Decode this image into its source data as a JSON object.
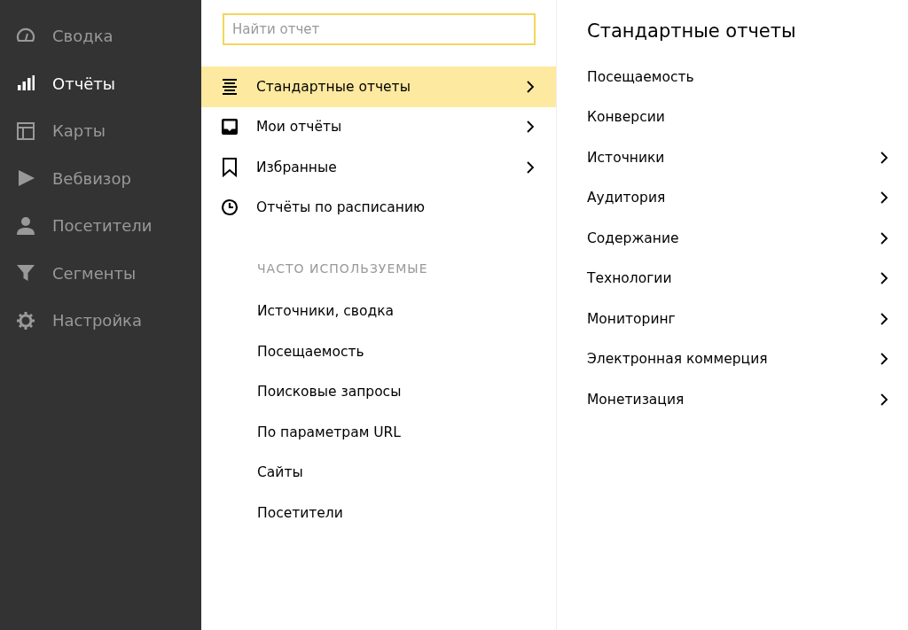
{
  "sidebar": {
    "items": [
      {
        "label": "Сводка",
        "selected": false
      },
      {
        "label": "Отчёты",
        "selected": true
      },
      {
        "label": "Карты",
        "selected": false
      },
      {
        "label": "Вебвизор",
        "selected": false
      },
      {
        "label": "Посетители",
        "selected": false
      },
      {
        "label": "Сегменты",
        "selected": false
      },
      {
        "label": "Настройка",
        "selected": false
      }
    ]
  },
  "reports_menu": {
    "search": {
      "placeholder": "Найти отчет"
    },
    "items": [
      {
        "label": "Стандартные отчеты",
        "selected": true,
        "has_submenu": true
      },
      {
        "label": "Мои отчёты",
        "selected": false,
        "has_submenu": true
      },
      {
        "label": "Избранные",
        "selected": false,
        "has_submenu": true
      },
      {
        "label": "Отчёты по расписанию",
        "selected": false,
        "has_submenu": false
      }
    ],
    "frequent_heading": "ЧАСТО ИСПОЛЬЗУЕМЫЕ",
    "frequent": [
      "Источники, сводка",
      "Посещаемость",
      "Поисковые запросы",
      "По параметрам URL",
      "Сайты",
      "Посетители"
    ]
  },
  "standard_reports": {
    "title": "Стандартные отчеты",
    "items": [
      {
        "label": "Посещаемость",
        "has_submenu": false
      },
      {
        "label": "Конверсии",
        "has_submenu": false
      },
      {
        "label": "Источники",
        "has_submenu": true
      },
      {
        "label": "Аудитория",
        "has_submenu": true
      },
      {
        "label": "Содержание",
        "has_submenu": true
      },
      {
        "label": "Технологии",
        "has_submenu": true
      },
      {
        "label": "Мониторинг",
        "has_submenu": true
      },
      {
        "label": "Электронная коммерция",
        "has_submenu": true
      },
      {
        "label": "Монетизация",
        "has_submenu": true
      }
    ]
  }
}
